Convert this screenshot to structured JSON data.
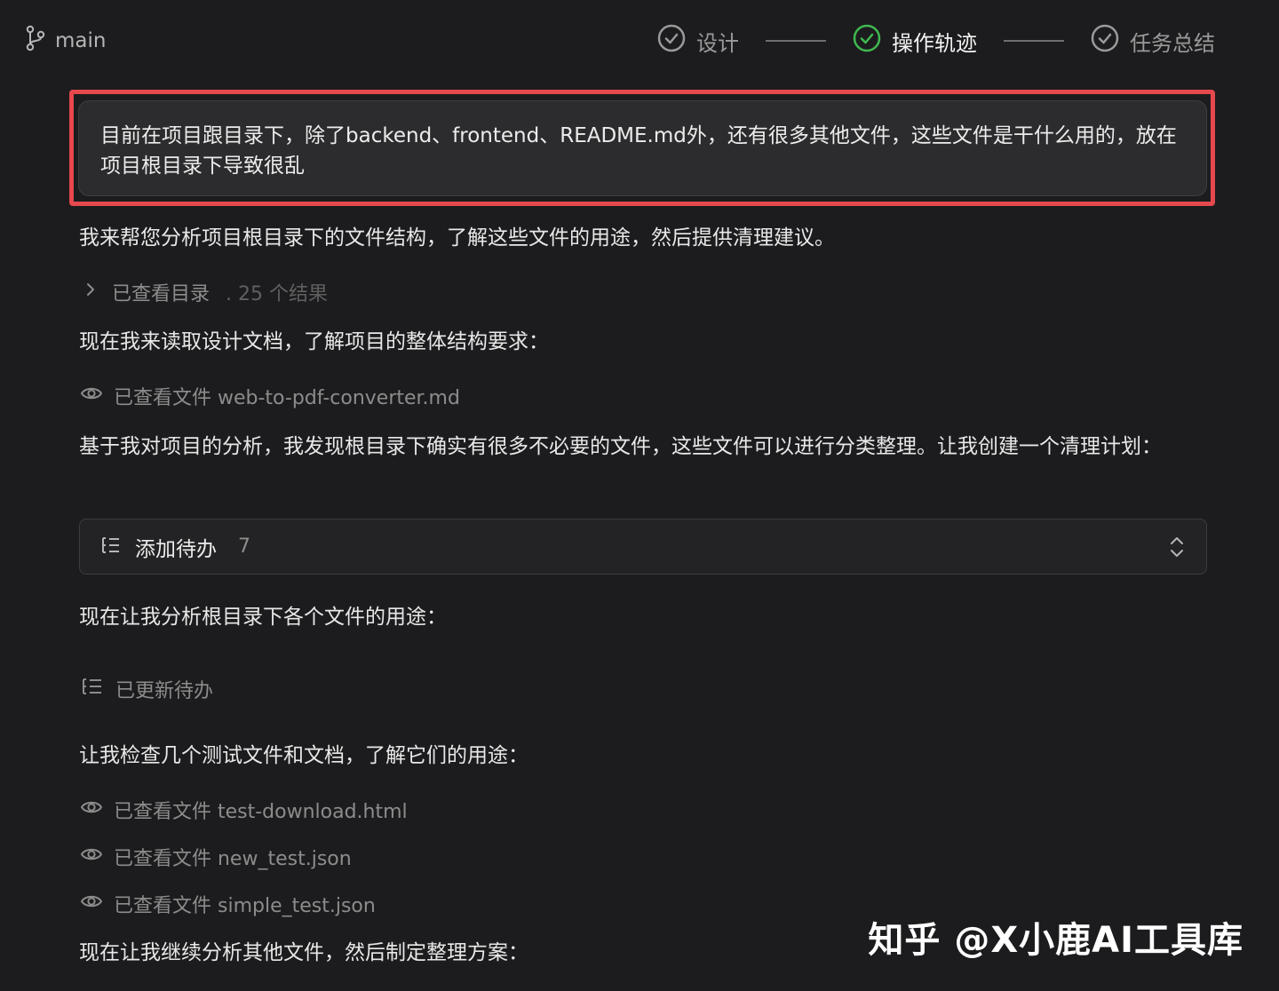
{
  "topbar": {
    "branch": "main",
    "steps": [
      {
        "label": "设计",
        "state": "done"
      },
      {
        "label": "操作轨迹",
        "state": "active"
      },
      {
        "label": "任务总结",
        "state": "done"
      }
    ]
  },
  "user_message": "目前在项目跟目录下，除了backend、frontend、README.md外，还有很多其他文件，这些文件是干什么用的，放在项目根目录下导致很乱",
  "messages": {
    "m1": "我来帮您分析项目根目录下的文件结构，了解这些文件的用途，然后提供清理建议。",
    "m2": "现在我来读取设计文档，了解项目的整体结构要求：",
    "m3": "基于我对项目的分析，我发现根目录下确实有很多不必要的文件，这些文件可以进行分类整理。让我创建一个清理计划：",
    "m4": "现在让我分析根目录下各个文件的用途：",
    "m5": "让我检查几个测试文件和文档，了解它们的用途：",
    "m6": "现在让我继续分析其他文件，然后制定整理方案："
  },
  "tools": {
    "dir": {
      "label": "已查看目录",
      "meta": ". 25 个结果"
    },
    "file1": {
      "label": "已查看文件 web-to-pdf-converter.md"
    },
    "todo_updated": {
      "label": "已更新待办"
    },
    "file2": {
      "label": "已查看文件 test-download.html"
    },
    "file3": {
      "label": "已查看文件 new_test.json"
    },
    "file4": {
      "label": "已查看文件 simple_test.json"
    }
  },
  "todo": {
    "title": "添加待办",
    "count": "7"
  },
  "watermark": "知乎 @X小鹿AI工具库",
  "colors": {
    "accent_green": "#3fb950",
    "highlight_red": "#e5484d",
    "background": "#1c1c1e"
  }
}
